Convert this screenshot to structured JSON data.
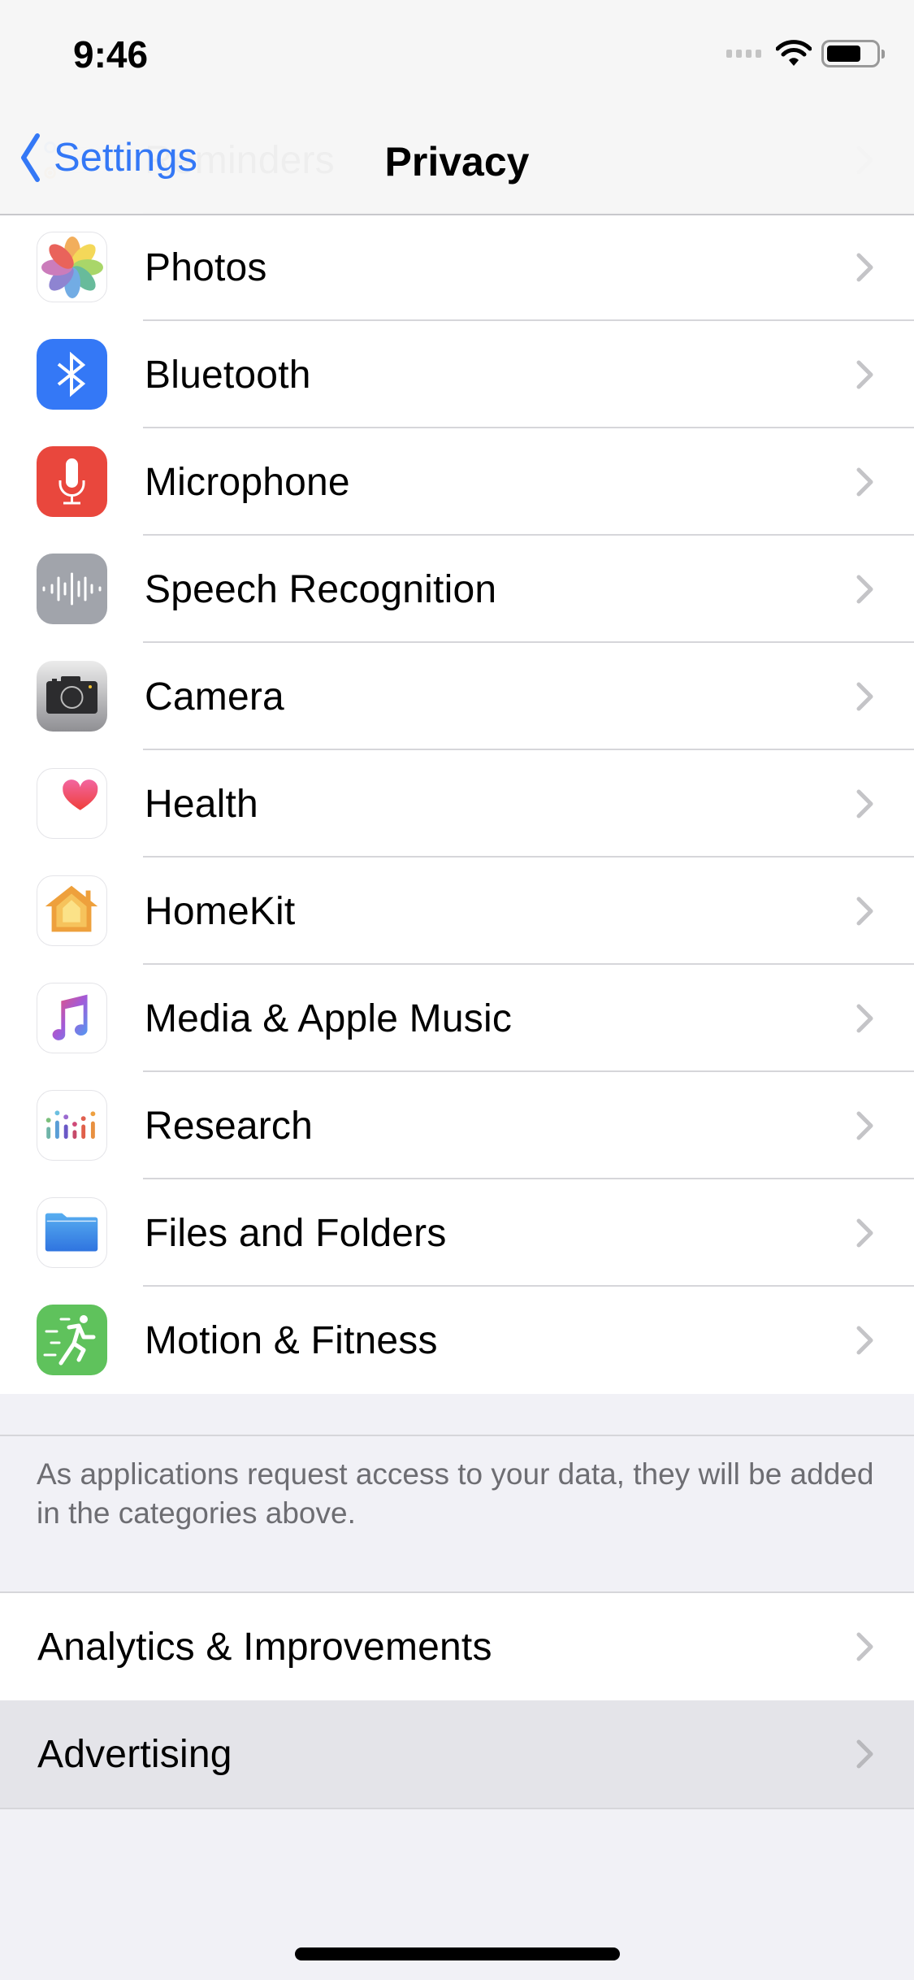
{
  "status_bar": {
    "time": "9:46",
    "icons": [
      "cellular-signal-icon",
      "wifi-icon",
      "battery-icon"
    ],
    "battery_level_percent": 70
  },
  "nav": {
    "back_label": "Settings",
    "title": "Privacy"
  },
  "colors": {
    "accent": "#3478f6",
    "background": "#f1f1f6",
    "separator": "#d6d6da",
    "footer_text": "#6d6d72",
    "highlight_row": "#e4e4e9"
  },
  "app_categories": [
    {
      "label": "Reminders",
      "icon": "reminders-icon",
      "partially_hidden": true
    },
    {
      "label": "Photos",
      "icon": "photos-icon"
    },
    {
      "label": "Bluetooth",
      "icon": "bluetooth-icon",
      "icon_bg": "#3478f6"
    },
    {
      "label": "Microphone",
      "icon": "microphone-icon",
      "icon_bg": "#e9473d"
    },
    {
      "label": "Speech Recognition",
      "icon": "speech-waveform-icon",
      "icon_bg": "#a1a4ab"
    },
    {
      "label": "Camera",
      "icon": "camera-icon"
    },
    {
      "label": "Health",
      "icon": "health-heart-icon"
    },
    {
      "label": "HomeKit",
      "icon": "homekit-house-icon"
    },
    {
      "label": "Media & Apple Music",
      "icon": "music-note-icon"
    },
    {
      "label": "Research",
      "icon": "research-icon"
    },
    {
      "label": "Files and Folders",
      "icon": "folder-icon"
    },
    {
      "label": "Motion & Fitness",
      "icon": "running-figure-icon",
      "icon_bg": "#5fc25c"
    }
  ],
  "footer_note": "As applications request access to your data, they will be added in the categories above.",
  "other_items": [
    {
      "label": "Analytics & Improvements",
      "highlighted": false
    },
    {
      "label": "Advertising",
      "highlighted": true
    }
  ]
}
